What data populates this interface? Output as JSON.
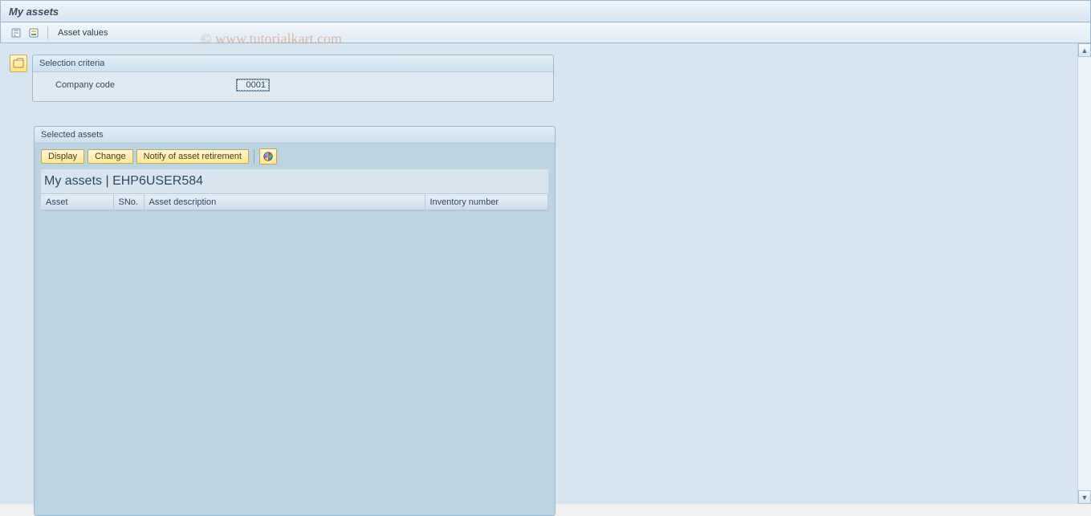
{
  "title": "My assets",
  "toolbar": {
    "asset_values": "Asset values"
  },
  "watermark": "© www.tutorialkart.com",
  "selection": {
    "title": "Selection criteria",
    "company_code_label": "Company code",
    "company_code_value": "0001"
  },
  "assets_panel": {
    "title": "Selected assets",
    "buttons": {
      "display": "Display",
      "change": "Change",
      "notify": "Notify of asset retirement"
    },
    "grid_title": "My assets  | EHP6USER584",
    "columns": [
      "Asset",
      "SNo.",
      "Asset description",
      "Inventory number"
    ],
    "rows": []
  }
}
